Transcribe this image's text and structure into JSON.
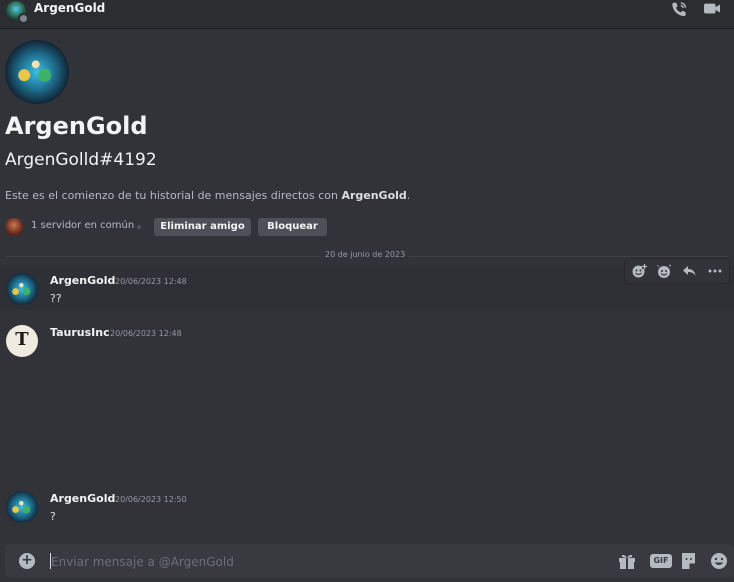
{
  "header": {
    "title": "ArgenGold",
    "status": "offline",
    "icons": [
      "voice-call-icon",
      "video-call-icon"
    ]
  },
  "profile": {
    "name": "ArgenGold",
    "tag": "ArgenGolld#4192",
    "description_prefix": "Este es el comienzo de tu historial de mensajes directos con ",
    "description_name": "ArgenGold",
    "description_suffix": ".",
    "mutual_servers": "1 servidor en común",
    "remove_friend_label": "Eliminar amigo",
    "block_label": "Bloquear"
  },
  "date_divider": "20 de junio de 2023",
  "messages": [
    {
      "author": "ArgenGold",
      "time": "20/06/2023 12:48",
      "text": "??"
    },
    {
      "author": "TaurusInc",
      "time": "20/06/2023 12:48",
      "text": "",
      "avatar_letter": "T"
    },
    {
      "author": "ArgenGold",
      "time": "20/06/2023 12:50",
      "text": "?"
    }
  ],
  "message_actions": [
    "add-reaction-icon",
    "super-reaction-icon",
    "reply-icon",
    "more-icon"
  ],
  "composer": {
    "placeholder": "Enviar mensaje a @ArgenGold",
    "gif_label": "GIF",
    "icons": [
      "add-attachment-icon",
      "gift-icon",
      "gif-icon",
      "sticker-icon",
      "emoji-icon"
    ]
  },
  "colors": {
    "background": "#313338",
    "header": "#2b2d31",
    "button": "#4e5058",
    "composer": "#383a40"
  }
}
